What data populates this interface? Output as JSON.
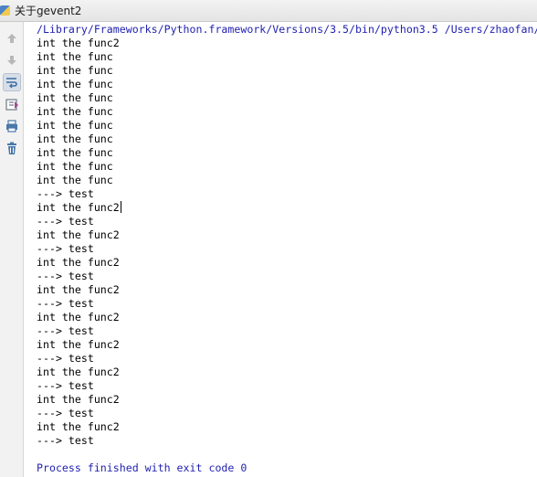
{
  "tab": {
    "title": "关于gevent2"
  },
  "toolbar": {
    "buttons": [
      {
        "name": "rerun-up-icon",
        "selected": false
      },
      {
        "name": "scroll-down-icon",
        "selected": false
      },
      {
        "name": "soft-wrap-icon",
        "selected": true
      },
      {
        "name": "scroll-to-end-icon",
        "selected": false
      },
      {
        "name": "print-icon",
        "selected": false
      },
      {
        "name": "trash-icon",
        "selected": false
      }
    ]
  },
  "console": {
    "command_line": "/Library/Frameworks/Python.framework/Versions/3.5/bin/python3.5 /Users/zhaofan/",
    "output_lines": [
      "int the func2",
      "int the func",
      "int the func",
      "int the func",
      "int the func",
      "int the func",
      "int the func",
      "int the func",
      "int the func",
      "int the func",
      "int the func",
      "---> test",
      "int the func2",
      "---> test",
      "int the func2",
      "---> test",
      "int the func2",
      "---> test",
      "int the func2",
      "---> test",
      "int the func2",
      "---> test",
      "int the func2",
      "---> test",
      "int the func2",
      "---> test",
      "int the func2",
      "---> test",
      "int the func2",
      "---> test"
    ],
    "blank": "",
    "exit_message": "Process finished with exit code 0"
  }
}
